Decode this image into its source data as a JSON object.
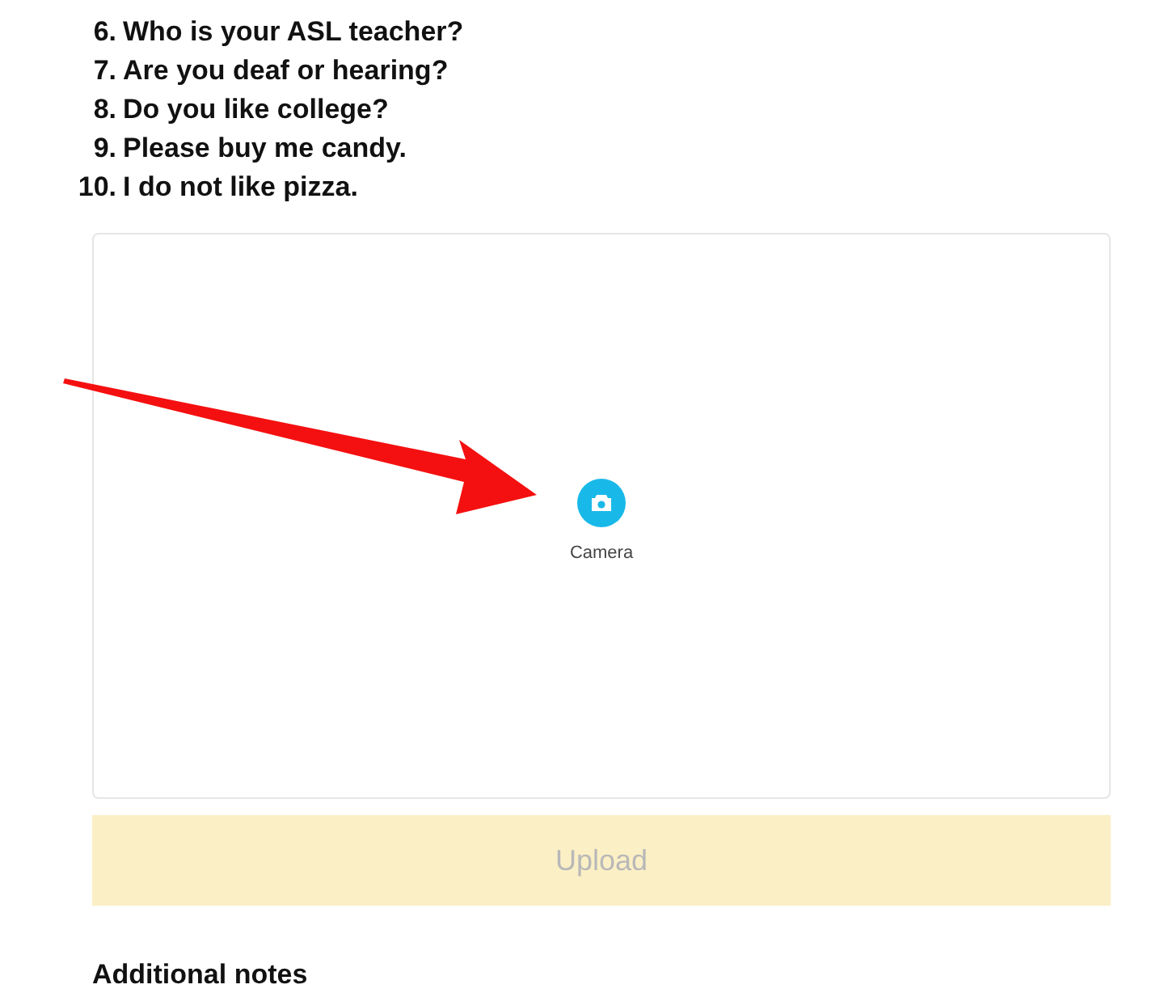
{
  "questions": [
    {
      "number": "6.",
      "text": "Who is your ASL teacher?"
    },
    {
      "number": "7.",
      "text": "Are you deaf or hearing?"
    },
    {
      "number": "8.",
      "text": "Do you like college?"
    },
    {
      "number": "9.",
      "text": "Please buy me candy."
    },
    {
      "number": "10.",
      "text": "I do not like pizza."
    }
  ],
  "capture": {
    "option_label": "Camera"
  },
  "upload_button": {
    "label": "Upload",
    "disabled": true
  },
  "notes_heading": "Additional notes"
}
